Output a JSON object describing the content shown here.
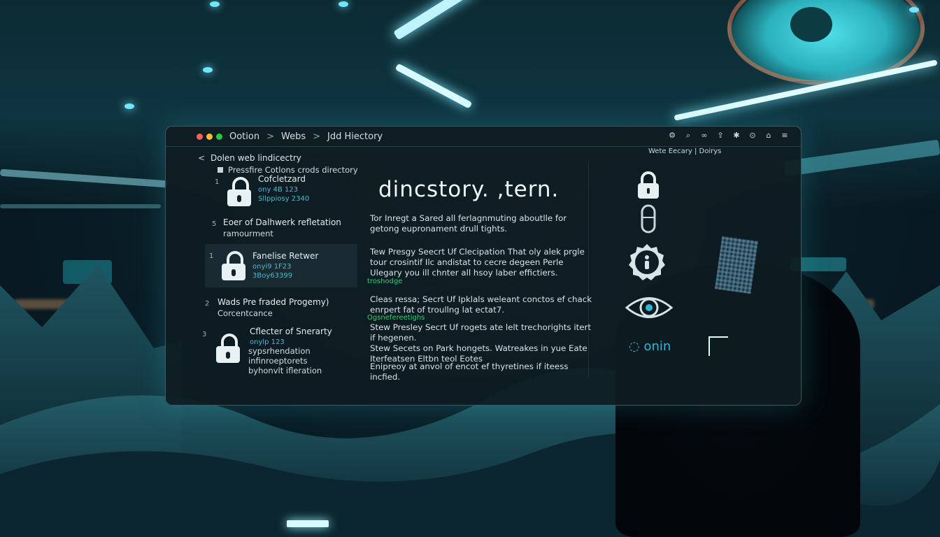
{
  "titlebar": {
    "traffic_lights": [
      "#ff5f57",
      "#febc2e",
      "#28c840"
    ],
    "breadcrumbs": [
      "Ootion",
      "Webs",
      "Jdd Hiectory"
    ],
    "separator": ">",
    "tools": [
      "gear-icon",
      "search-icon",
      "link-icon",
      "share-icon",
      "settings-icon",
      "lock-icon",
      "bookmark-icon",
      "menu-icon"
    ]
  },
  "sidebar": {
    "back_icon": "<",
    "title": "Dolen web lindicectry",
    "subtitle": "Pressfire Cotlons crods directory",
    "items": [
      {
        "num": "1",
        "label": "Cofcletzard",
        "meta": "ony 4B 123\nSllppiosy 2340"
      },
      {
        "num": "5",
        "label": "Eoer of Dalhwerk refletation",
        "sub": "ramourment"
      },
      {
        "num": "1",
        "label": "Fanelise Retwer",
        "meta": "onyi9 1F23\n3Boy63399"
      },
      {
        "num": "2",
        "label": "Wads Pre fraded Progemy)",
        "sub": "Corcentcance"
      },
      {
        "num": "3",
        "label": "Cflecter of Snerarty",
        "meta": "onylp 123",
        "sub": "sypsrhendation\ninfinroeptorets\nbyhonvlt ifleration"
      }
    ]
  },
  "main": {
    "title": "dincstory. ,tern.",
    "paragraphs": [
      "Tor Inregt a Sared all ferlagnmuting aboutlle for getong eupronament drull tights.",
      "Tew Presgy Seecrt Uf Clecipation That oly alek prgle tour crosintif Ilc andistat to cecre degeen Perle Ulegary you ill chnter all hsoy laber effictiers.",
      "Cleas ressa; Secrt Uf Ipklals weleant conctos ef chack enrpert fat of troullng lat ectat7.",
      "Stew Presley Secrt Uf rogets ate lelt trechorights itert if hegenen.",
      "Stew Secets on Park hongets. Watreakes in yue Eate Iterfeatsen Eltbn teol Eotes",
      "Enipreoy at anvol of encot ef thyretines if iteess incfied."
    ],
    "green_labels": [
      "troshodge",
      "Ogsnefereetighs"
    ]
  },
  "right_panel": {
    "header": "Wete Eecary  |  Doirys",
    "icons": [
      "padlock-icon",
      "capsule-icon",
      "info-shield-icon",
      "eye-icon"
    ],
    "brand_text": "onin"
  }
}
